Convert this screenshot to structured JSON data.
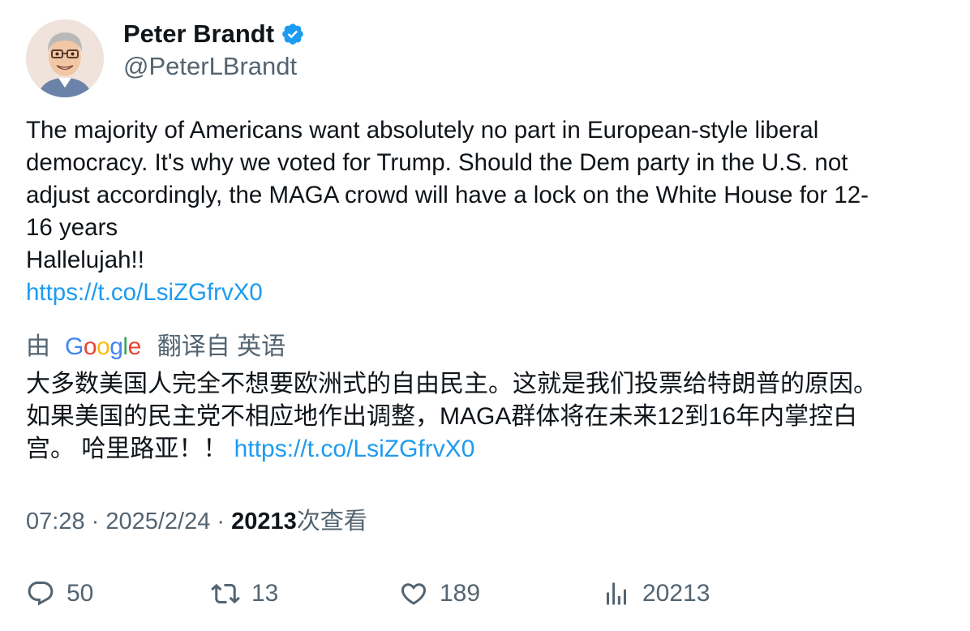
{
  "author": {
    "name": "Peter Brandt",
    "handle": "@PeterLBrandt",
    "verified": true
  },
  "tweet": {
    "lines": [
      "The majority of Americans want absolutely no part in European-style liberal",
      "democracy. It's why we voted for Trump. Should the Dem party in the U.S. not",
      "adjust accordingly, the MAGA crowd will have a lock on the White House for 12-",
      "16 years",
      "Hallelujah!!"
    ],
    "link": "https://t.co/LsiZGfrvX0"
  },
  "translation_notice": {
    "prefix": "由",
    "google_letters": [
      "G",
      "o",
      "o",
      "g",
      "l",
      "e"
    ],
    "google_colors": [
      "#4285F4",
      "#EA4335",
      "#FBBC05",
      "#4285F4",
      "#34A853",
      "#EA4335"
    ],
    "suffix": "翻译自 英语"
  },
  "translation": {
    "lines": [
      "大多数美国人完全不想要欧洲式的自由民主。这就是我们投票给特朗普的原因。",
      "如果美国的民主党不相应地作出调整，MAGA群体将在未来12到16年内掌控白",
      "宫。 哈里路亚！！ "
    ],
    "link": "https://t.co/LsiZGfrvX0"
  },
  "meta": {
    "time": "07:28",
    "separator": " · ",
    "date": "2025/2/24",
    "views_count": "20213",
    "views_label": "次查看"
  },
  "actions": {
    "replies": "50",
    "retweets": "13",
    "likes": "189",
    "views": "20213"
  },
  "colors": {
    "link": "#1d9bf0",
    "secondary_text": "#536471",
    "verified_badge": "#1d9bf0"
  }
}
